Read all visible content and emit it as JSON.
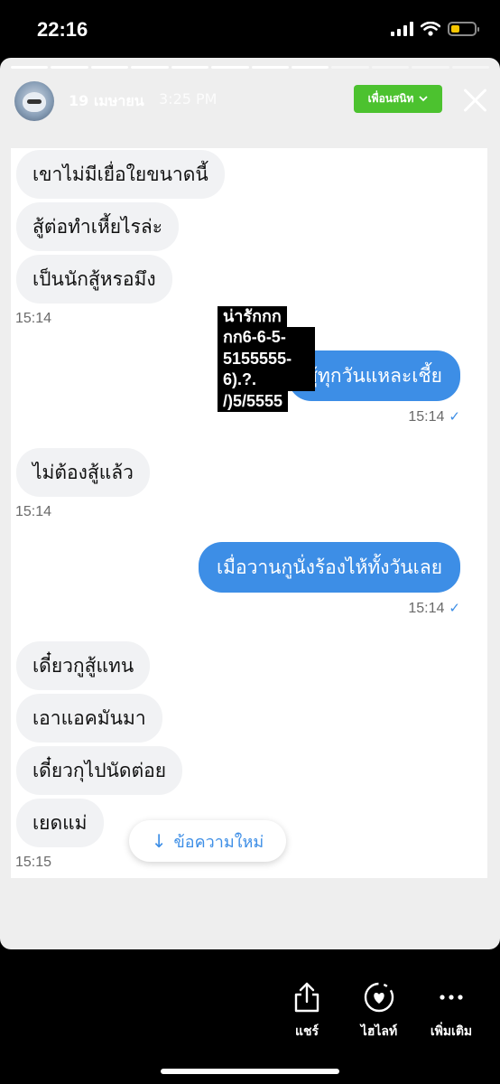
{
  "status_bar": {
    "time": "22:16",
    "battery_color": "#f7c600"
  },
  "story": {
    "date": "19 เมษายน",
    "time": "3:25 PM",
    "close_friends_label": "เพื่อนสนิท",
    "chevron_icon": "chevron-down-icon",
    "close_icon": "close-icon"
  },
  "chat": {
    "messages": [
      {
        "text": "เขาไม่มีเยื่อใยขนาดนี้",
        "side": "in"
      },
      {
        "text": "สู้ต่อทำเหี้ยไรล่ะ",
        "side": "in"
      },
      {
        "text": "เป็นนักสู้หรอมึง",
        "side": "in"
      },
      {
        "text": "สู้ทุกวันแหละเชี้ย",
        "side": "out"
      },
      {
        "text": "ไม่ต้องสู้แล้ว",
        "side": "in"
      },
      {
        "text": "เมื่อวานกูนั่งร้องไห้ทั้งวันเลย",
        "side": "out"
      },
      {
        "text": "เดี๋ยวกูสู้แทน",
        "side": "in"
      },
      {
        "text": "เอาแอคมันมา",
        "side": "in"
      },
      {
        "text": "เดี๋ยวกุไปนัดต่อย",
        "side": "in"
      },
      {
        "text": "เยดแม่",
        "side": "in"
      }
    ],
    "timestamps": [
      "15:14",
      "15:14",
      "15:14",
      "15:14",
      "15:14",
      "15:15"
    ],
    "read_tick": "✓",
    "incoming_color": "#f1f2f4",
    "outgoing_color": "#3d8ee6"
  },
  "sticker": {
    "lines": [
      "น่ารักกก",
      "กก6-6-5-5155555-6).?.",
      "/)5/5555"
    ]
  },
  "new_messages_button": {
    "arrow": "↓",
    "label": "ข้อความใหม่"
  },
  "bottom_actions": [
    {
      "label": "แชร์",
      "icon": "share-icon"
    },
    {
      "label": "ไฮไลท์",
      "icon": "highlight-heart-icon"
    },
    {
      "label": "เพิ่มเติม",
      "icon": "more-icon"
    }
  ]
}
